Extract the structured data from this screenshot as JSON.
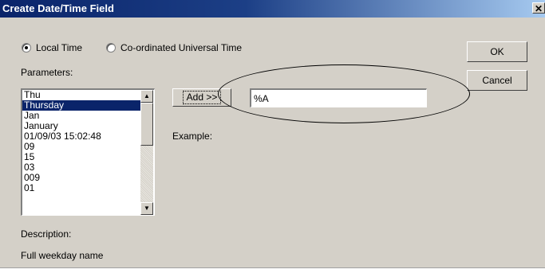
{
  "window": {
    "title": "Create Date/Time Field",
    "close_glyph": "✕"
  },
  "time_mode": {
    "local_time_label": "Local Time",
    "utc_label": "Co-ordinated Universal Time",
    "selected": "local"
  },
  "parameters": {
    "label": "Parameters:",
    "items": [
      "Thu",
      "Thursday",
      "Jan",
      "January",
      "01/09/03 15:02:48",
      "09",
      "15",
      "03",
      "009",
      "01"
    ],
    "selected_index": 1
  },
  "add_button": {
    "label": "Add >>"
  },
  "format_field": {
    "value": "%A"
  },
  "example_label": "Example:",
  "buttons": {
    "ok": "OK",
    "cancel": "Cancel"
  },
  "description": {
    "label": "Description:",
    "text": "Full weekday name"
  },
  "icons": {
    "scroll_up": "▲",
    "scroll_down": "▼"
  }
}
